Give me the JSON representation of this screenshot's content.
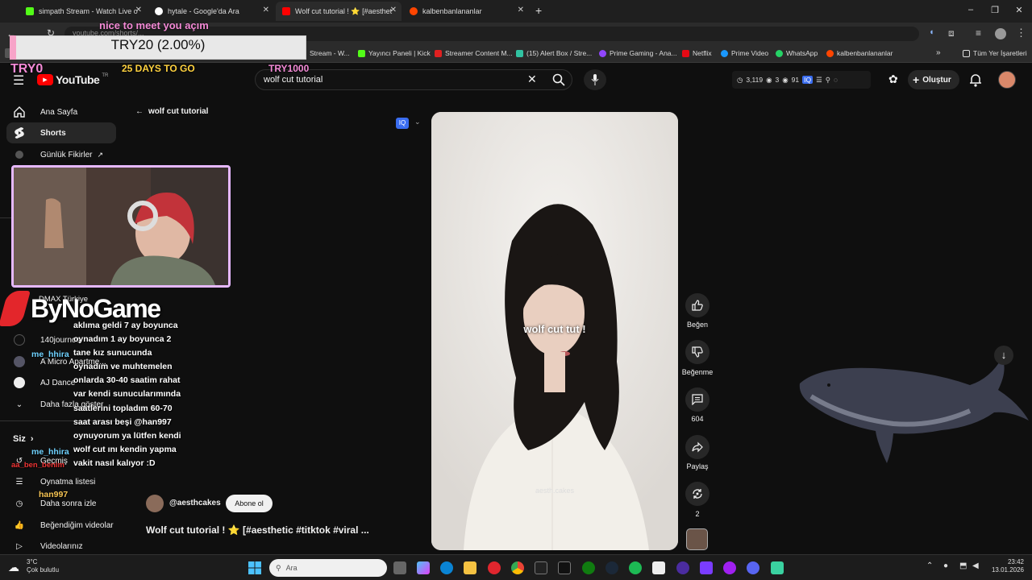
{
  "browser": {
    "tabs": [
      {
        "title": "simpath Stream - Watch Live o",
        "color": "#53fc18"
      },
      {
        "title": "hytale - Google'da Ara",
        "color": "#ffffff"
      },
      {
        "title": "Wolf cut tutorial ! ⭐ [#aesthet",
        "color": "#ff0000"
      },
      {
        "title": "kalbenbanlananlar",
        "color": "#ff4500"
      }
    ],
    "url": "youtube.com/shorts/...",
    "bookmarks": [
      {
        "label": "Stream - W...",
        "color": "#53fc18"
      },
      {
        "label": "Yayıncı Paneli | Kick",
        "color": "#53fc18"
      },
      {
        "label": "Streamer Content M...",
        "color": "#e02020"
      },
      {
        "label": "(15) Alert Box / Stre...",
        "color": "#31c3a2"
      },
      {
        "label": "Prime Gaming - Ana...",
        "color": "#9146ff"
      },
      {
        "label": "Netflix",
        "color": "#e50914"
      },
      {
        "label": "Prime Video",
        "color": "#1a98ff"
      },
      {
        "label": "WhatsApp",
        "color": "#25d366"
      },
      {
        "label": "kalbenbanlananlar",
        "color": "#ff4500"
      }
    ],
    "all_bookmarks": "Tüm Yer İşaretleri"
  },
  "youtube": {
    "logo": "YouTube",
    "logo_sup": "TR",
    "search_value": "wolf cut tutorial",
    "header_stats": {
      "a": "3,119",
      "b": "3",
      "c": "91"
    },
    "create_label": "Oluştur",
    "back_label": "wolf cut tutorial",
    "sidebar": [
      {
        "label": "Ana Sayfa",
        "icon": "home-icon"
      },
      {
        "label": "Shorts",
        "icon": "shorts-icon"
      },
      {
        "label": "Günlük Fikirler",
        "icon": "ideas-icon"
      }
    ],
    "subs": [
      {
        "label": "DMAX Türkiye"
      },
      {
        "label": "140journos"
      },
      {
        "label": "A Micro Apartme..."
      },
      {
        "label": "AJ Dance"
      }
    ],
    "show_more": "Daha fazla göster",
    "you_title": "Siz",
    "you_items": [
      {
        "label": "Geçmiş"
      },
      {
        "label": "Oynatma listesi"
      },
      {
        "label": "Daha sonra izle"
      },
      {
        "label": "Beğendiğim videolar"
      },
      {
        "label": "Videolarınız"
      }
    ],
    "short": {
      "caption": "wolf cut tut !",
      "watermark": "aesth.cakes",
      "channel": "@aesthcakes",
      "subscribe": "Abone ol",
      "title": "Wolf cut tutorial ! ⭐ [#aesthetic #titktok #viral ..."
    },
    "actions": [
      {
        "label": "Beğen",
        "icon": "thumbs-up-icon"
      },
      {
        "label": "Beğenme",
        "icon": "thumbs-down-icon"
      },
      {
        "label": "604",
        "icon": "comment-icon"
      },
      {
        "label": "Paylaş",
        "icon": "share-icon"
      },
      {
        "label": "2",
        "icon": "remix-icon"
      }
    ]
  },
  "overlay": {
    "donation_text": "TRY20 (2.00%)",
    "donation_fraction": 0.02,
    "greeting": "nice to meet you açım",
    "goal_left": "TRY0",
    "goal_days": "25 DAYS TO GO",
    "goal_right": "TRY1000",
    "brand": "ByNoGame",
    "chat_names": [
      "me_hhira",
      "me_hhira",
      "aa_ben_benim",
      "han997"
    ],
    "chat_messages": "aklıma geldi 7 ay boyunca oynadım 1 ay boyunca 2 tane kız sunucunda oynadım ve muhtemelen onlarda 30-40 saatim rahat var kendi sunucularımında saatlerini topladım 60-70 saat arası beşi @han997 oynuyorum ya lütfen kendi wolf cut ını kendin yapma vakit nasıl kalıyor :D"
  },
  "taskbar": {
    "temp": "3°C",
    "weather": "Çok bulutlu",
    "search_placeholder": "Ara",
    "time": "23:42",
    "date": "13.01.2026"
  }
}
